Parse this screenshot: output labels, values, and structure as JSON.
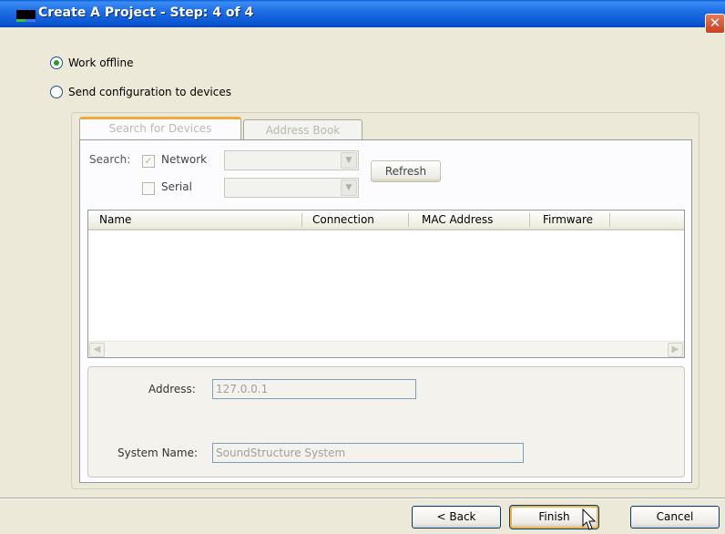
{
  "window": {
    "title": "Create A Project - Step: 4 of 4",
    "close_glyph": "✕"
  },
  "options": {
    "work_offline": "Work offline",
    "send_config": "Send configuration to devices"
  },
  "tabs": {
    "search": "Search for Devices",
    "address_book": "Address Book"
  },
  "search": {
    "label": "Search:",
    "network": "Network",
    "serial": "Serial",
    "refresh": "Refresh"
  },
  "device_list": {
    "columns": [
      "Name",
      "Connection",
      "MAC Address",
      "Firmware"
    ]
  },
  "info": {
    "address_label": "Address:",
    "address_value": "127.0.0.1",
    "system_name_label": "System Name:",
    "system_name_value": "SoundStructure System"
  },
  "buttons": {
    "back": "< Back",
    "finish": "Finish",
    "cancel": "Cancel"
  }
}
